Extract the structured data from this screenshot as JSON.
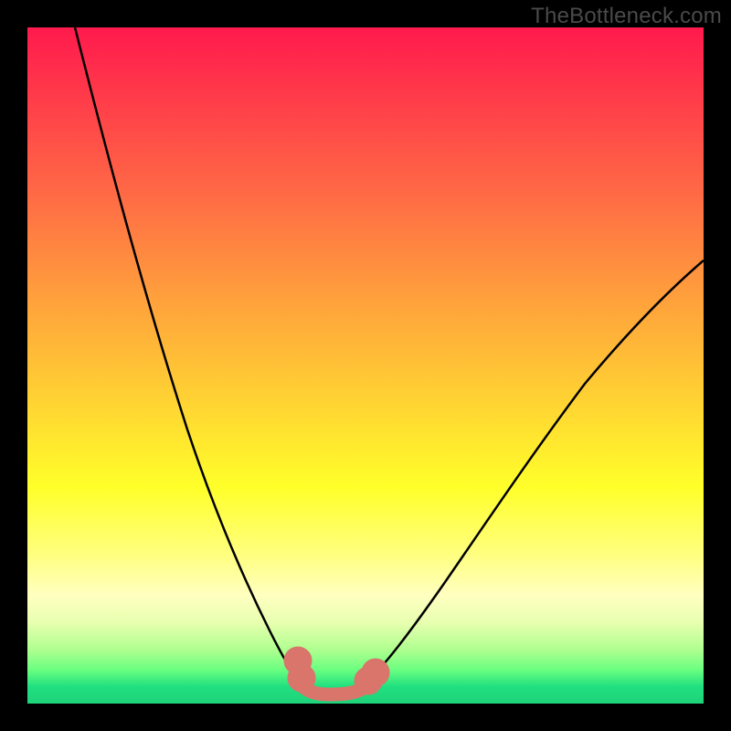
{
  "watermark": "TheBottleneck.com",
  "chart_data": {
    "type": "line",
    "title": "",
    "xlabel": "",
    "ylabel": "",
    "xlim": [
      0,
      100
    ],
    "ylim": [
      0,
      100
    ],
    "grid": false,
    "legend": false,
    "description": "Bottleneck percentage curve. Two descending black curve branches meet at a flat minimum (optimal zone) highlighted with thick salmon marker segment near the bottom. Background vertical gradient encodes bottleneck severity: red (top, high %) through orange, yellow, pale yellow to green (bottom, 0%).",
    "series": [
      {
        "name": "left-branch",
        "x": [
          7,
          12,
          17,
          21,
          25,
          29,
          32,
          35,
          38,
          40
        ],
        "y": [
          100,
          80,
          60,
          45,
          32,
          22,
          14,
          8,
          4,
          2
        ],
        "stroke": "#000000"
      },
      {
        "name": "right-branch",
        "x": [
          50,
          55,
          60,
          66,
          73,
          80,
          88,
          95,
          100
        ],
        "y": [
          2,
          5,
          10,
          18,
          28,
          40,
          52,
          62,
          68
        ],
        "stroke": "#000000"
      },
      {
        "name": "optimal-marker",
        "x": [
          38,
          40,
          42,
          44,
          46,
          48,
          50
        ],
        "y": [
          4,
          2,
          1.5,
          1.5,
          1.5,
          1.8,
          2.2
        ],
        "stroke": "#d9756b",
        "stroke_width": 14
      }
    ],
    "gradient_colors": {
      "top": "#ff1a4d",
      "mid_orange": "#ffa03c",
      "mid_yellow": "#ffff2a",
      "pale": "#ffffc0",
      "green": "#1fd27a"
    }
  }
}
